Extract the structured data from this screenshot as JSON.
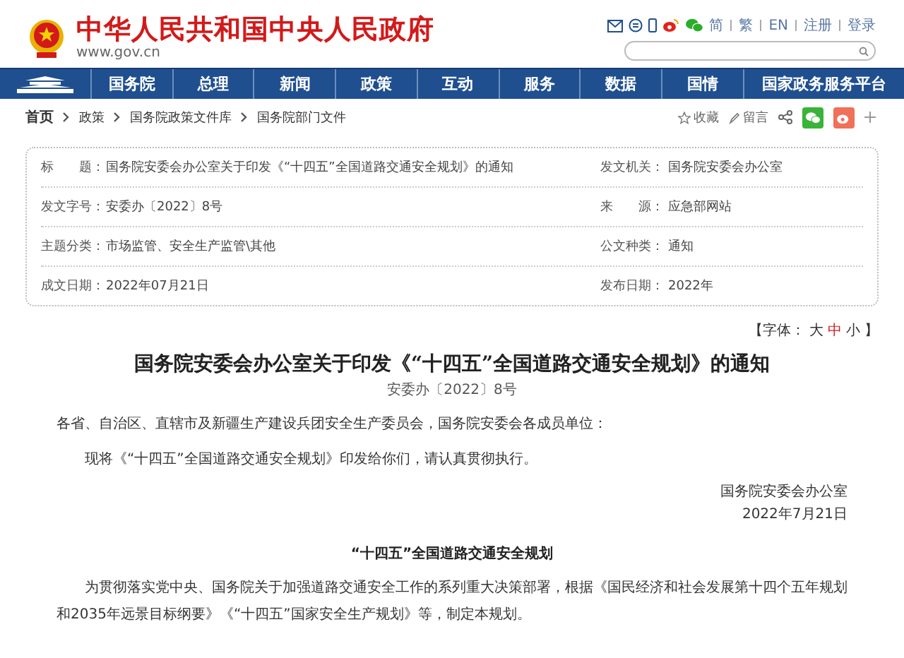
{
  "header": {
    "site_title": "中华人民共和国中央人民政府",
    "site_url": "www.gov.cn",
    "languages": [
      "简",
      "繁",
      "EN"
    ],
    "account_links": [
      "注册",
      "登录"
    ]
  },
  "nav": {
    "items": [
      {
        "label": "国务院",
        "selected": false
      },
      {
        "label": "总理",
        "selected": false
      },
      {
        "label": "新闻",
        "selected": false
      },
      {
        "label": "政策",
        "selected": false
      },
      {
        "label": "互动",
        "selected": false
      },
      {
        "label": "服务",
        "selected": false
      },
      {
        "label": "数据",
        "selected": false
      },
      {
        "label": "国情",
        "selected": false
      },
      {
        "label": "国家政务服务平台",
        "selected": false
      }
    ]
  },
  "breadcrumb": [
    "首页",
    "政策",
    "国务院政策文件库",
    "国务院部门文件"
  ],
  "actions": [
    "收藏",
    "留言"
  ],
  "info_table": [
    [
      {
        "label": "标　　题：",
        "value": "国务院安委会办公室关于印发《“十四五”全国道路交通安全规划》的通知"
      },
      {
        "label": "发文机关：",
        "value": "国务院安委会办公室"
      }
    ],
    [
      {
        "label": "发文字号：",
        "value": "安委办〔2022〕8号"
      },
      {
        "label": "来　　源：",
        "value": "应急部网站"
      }
    ],
    [
      {
        "label": "主题分类：",
        "value": "市场监管、安全生产监管\\其他"
      },
      {
        "label": "公文种类：",
        "value": "通知"
      }
    ],
    [
      {
        "label": "成文日期：",
        "value": "2022年07月21日"
      },
      {
        "label": "发布日期：",
        "value": "2022年"
      }
    ]
  ],
  "font_size": {
    "prefix": "【字体：",
    "suffix": "】",
    "options": [
      {
        "label": "大",
        "selected": false
      },
      {
        "label": "中",
        "selected": true
      },
      {
        "label": "小",
        "selected": false
      }
    ]
  },
  "article": {
    "title": "国务院安委会办公室关于印发《“十四五”全国道路交通安全规划》的通知",
    "doc_number": "安委办〔2022〕8号",
    "salutation": "各省、自治区、直辖市及新疆生产建设兵团安全生产委员会，国务院安委会各成员单位：",
    "body": "现将《“十四五”全国道路交通安全规划》印发给你们，请认真贯彻执行。",
    "signature": "国务院安委会办公室",
    "date": "2022年7月21日",
    "section_title": "“十四五”全国道路交通安全规划",
    "intro": "为贯彻落实党中央、国务院关于加强道路交通安全工作的系列重大决策部署，根据《国民经济和社会发展第十四个五年规划和2035年远景目标纲要》《“十四五”国家安全生产规划》等，制定本规划。"
  }
}
